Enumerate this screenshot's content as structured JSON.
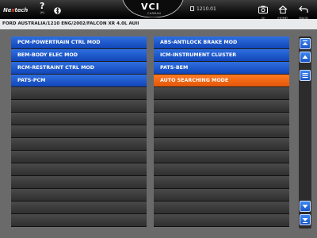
{
  "topbar": {
    "brand_prefix": "Ne",
    "brand_x": "x",
    "brand_suffix": "tech",
    "help_label": "(H)",
    "help_icon": "question-icon",
    "bluetooth_icon": "bluetooth-icon",
    "vci_text": "VCI",
    "vci_sub": "CARMAN",
    "version": "1210.01",
    "screenshot_label": "(S)",
    "home_label": "(HOME)",
    "back_label": "(BACK)"
  },
  "breadcrumb": "FORD AUSTRALIA/1210 ENG/2002/FALCON XR 4.0L AUII",
  "modules": {
    "left": [
      "PCM-POWERTRAIN CTRL MOD",
      "BEM-BODY ELEC MOD",
      "RCM-RESTRAINT CTRL MOD",
      "PATS-PCM"
    ],
    "right": [
      "ABS-ANTILOCK BRAKE MOD",
      "ICM-INSTRUMENT CLUSTER",
      "PATS-BEM",
      "AUTO SEARCHING MODE"
    ],
    "total_rows": 15,
    "selected": "AUTO SEARCHING MODE"
  },
  "colors": {
    "item_blue": "#1e5ed6",
    "item_selected": "#f26a14",
    "empty_row": "#3a3a3a"
  }
}
